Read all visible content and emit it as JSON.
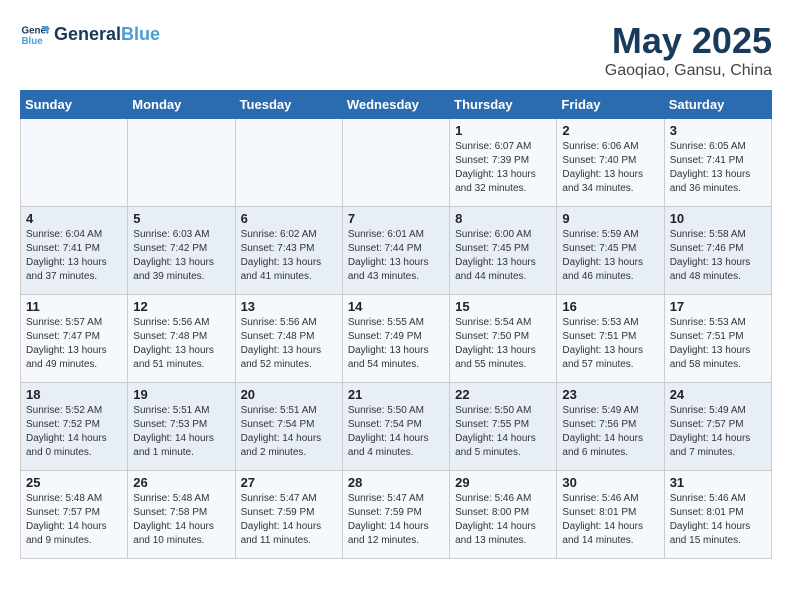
{
  "header": {
    "logo_line1": "General",
    "logo_line2": "Blue",
    "month": "May 2025",
    "location": "Gaoqiao, Gansu, China"
  },
  "days_of_week": [
    "Sunday",
    "Monday",
    "Tuesday",
    "Wednesday",
    "Thursday",
    "Friday",
    "Saturday"
  ],
  "weeks": [
    [
      {
        "day": "",
        "info": ""
      },
      {
        "day": "",
        "info": ""
      },
      {
        "day": "",
        "info": ""
      },
      {
        "day": "",
        "info": ""
      },
      {
        "day": "1",
        "info": "Sunrise: 6:07 AM\nSunset: 7:39 PM\nDaylight: 13 hours\nand 32 minutes."
      },
      {
        "day": "2",
        "info": "Sunrise: 6:06 AM\nSunset: 7:40 PM\nDaylight: 13 hours\nand 34 minutes."
      },
      {
        "day": "3",
        "info": "Sunrise: 6:05 AM\nSunset: 7:41 PM\nDaylight: 13 hours\nand 36 minutes."
      }
    ],
    [
      {
        "day": "4",
        "info": "Sunrise: 6:04 AM\nSunset: 7:41 PM\nDaylight: 13 hours\nand 37 minutes."
      },
      {
        "day": "5",
        "info": "Sunrise: 6:03 AM\nSunset: 7:42 PM\nDaylight: 13 hours\nand 39 minutes."
      },
      {
        "day": "6",
        "info": "Sunrise: 6:02 AM\nSunset: 7:43 PM\nDaylight: 13 hours\nand 41 minutes."
      },
      {
        "day": "7",
        "info": "Sunrise: 6:01 AM\nSunset: 7:44 PM\nDaylight: 13 hours\nand 43 minutes."
      },
      {
        "day": "8",
        "info": "Sunrise: 6:00 AM\nSunset: 7:45 PM\nDaylight: 13 hours\nand 44 minutes."
      },
      {
        "day": "9",
        "info": "Sunrise: 5:59 AM\nSunset: 7:45 PM\nDaylight: 13 hours\nand 46 minutes."
      },
      {
        "day": "10",
        "info": "Sunrise: 5:58 AM\nSunset: 7:46 PM\nDaylight: 13 hours\nand 48 minutes."
      }
    ],
    [
      {
        "day": "11",
        "info": "Sunrise: 5:57 AM\nSunset: 7:47 PM\nDaylight: 13 hours\nand 49 minutes."
      },
      {
        "day": "12",
        "info": "Sunrise: 5:56 AM\nSunset: 7:48 PM\nDaylight: 13 hours\nand 51 minutes."
      },
      {
        "day": "13",
        "info": "Sunrise: 5:56 AM\nSunset: 7:48 PM\nDaylight: 13 hours\nand 52 minutes."
      },
      {
        "day": "14",
        "info": "Sunrise: 5:55 AM\nSunset: 7:49 PM\nDaylight: 13 hours\nand 54 minutes."
      },
      {
        "day": "15",
        "info": "Sunrise: 5:54 AM\nSunset: 7:50 PM\nDaylight: 13 hours\nand 55 minutes."
      },
      {
        "day": "16",
        "info": "Sunrise: 5:53 AM\nSunset: 7:51 PM\nDaylight: 13 hours\nand 57 minutes."
      },
      {
        "day": "17",
        "info": "Sunrise: 5:53 AM\nSunset: 7:51 PM\nDaylight: 13 hours\nand 58 minutes."
      }
    ],
    [
      {
        "day": "18",
        "info": "Sunrise: 5:52 AM\nSunset: 7:52 PM\nDaylight: 14 hours\nand 0 minutes."
      },
      {
        "day": "19",
        "info": "Sunrise: 5:51 AM\nSunset: 7:53 PM\nDaylight: 14 hours\nand 1 minute."
      },
      {
        "day": "20",
        "info": "Sunrise: 5:51 AM\nSunset: 7:54 PM\nDaylight: 14 hours\nand 2 minutes."
      },
      {
        "day": "21",
        "info": "Sunrise: 5:50 AM\nSunset: 7:54 PM\nDaylight: 14 hours\nand 4 minutes."
      },
      {
        "day": "22",
        "info": "Sunrise: 5:50 AM\nSunset: 7:55 PM\nDaylight: 14 hours\nand 5 minutes."
      },
      {
        "day": "23",
        "info": "Sunrise: 5:49 AM\nSunset: 7:56 PM\nDaylight: 14 hours\nand 6 minutes."
      },
      {
        "day": "24",
        "info": "Sunrise: 5:49 AM\nSunset: 7:57 PM\nDaylight: 14 hours\nand 7 minutes."
      }
    ],
    [
      {
        "day": "25",
        "info": "Sunrise: 5:48 AM\nSunset: 7:57 PM\nDaylight: 14 hours\nand 9 minutes."
      },
      {
        "day": "26",
        "info": "Sunrise: 5:48 AM\nSunset: 7:58 PM\nDaylight: 14 hours\nand 10 minutes."
      },
      {
        "day": "27",
        "info": "Sunrise: 5:47 AM\nSunset: 7:59 PM\nDaylight: 14 hours\nand 11 minutes."
      },
      {
        "day": "28",
        "info": "Sunrise: 5:47 AM\nSunset: 7:59 PM\nDaylight: 14 hours\nand 12 minutes."
      },
      {
        "day": "29",
        "info": "Sunrise: 5:46 AM\nSunset: 8:00 PM\nDaylight: 14 hours\nand 13 minutes."
      },
      {
        "day": "30",
        "info": "Sunrise: 5:46 AM\nSunset: 8:01 PM\nDaylight: 14 hours\nand 14 minutes."
      },
      {
        "day": "31",
        "info": "Sunrise: 5:46 AM\nSunset: 8:01 PM\nDaylight: 14 hours\nand 15 minutes."
      }
    ]
  ]
}
